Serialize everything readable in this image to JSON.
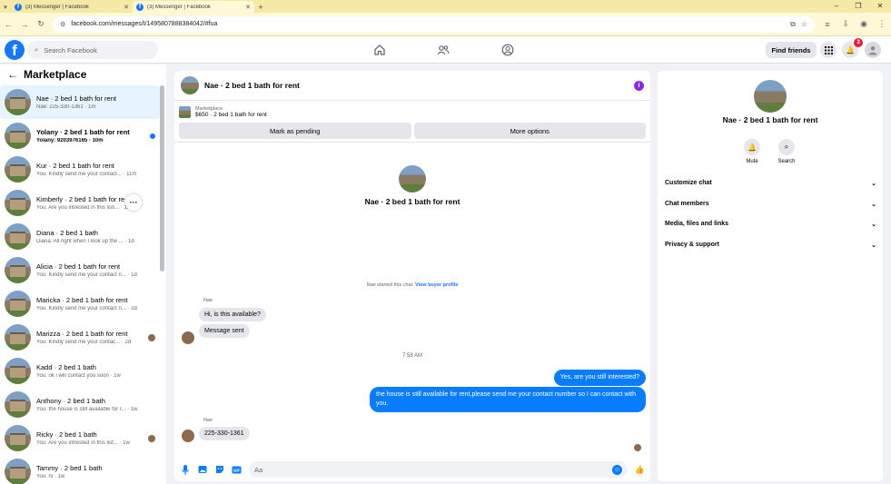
{
  "browser": {
    "tabs": [
      {
        "title": "(3) Messenger | Facebook",
        "active": false
      },
      {
        "title": "(3) Messenger | Facebook",
        "active": true
      }
    ],
    "url": "facebook.com/messages/t/1495807888384042/#fua"
  },
  "header": {
    "search_placeholder": "Search Facebook",
    "find_friends": "Find friends",
    "notification_count": "3"
  },
  "left": {
    "title": "Marketplace",
    "conversations": [
      {
        "name": "Nae · 2 bed 1 bath for rent",
        "preview": "Nae: 225-330-1361 · 1m",
        "selected": true
      },
      {
        "name": "Yolany · 2 bed 1 bath for rent",
        "preview": "Yolany: 9203976165 · 10m",
        "unread": true
      },
      {
        "name": "Kur · 2 bed 1 bath for rent",
        "preview": "You: Kindly send me your contact... · 11m"
      },
      {
        "name": "Kimberly · 2 bed 1 bath for re",
        "preview": "You: Are you intrested in this listi... · 1h"
      },
      {
        "name": "Diana · 2 bed 1 bath",
        "preview": "Diana: All right when I look up the ... · 1d"
      },
      {
        "name": "Alicia · 2 bed 1 bath for rent",
        "preview": "You: Kindly send me your contact n... · 1d"
      },
      {
        "name": "Maricka · 2 bed 1 bath for rent",
        "preview": "You: Kindly send me your contact n... · 2d"
      },
      {
        "name": "Marizza · 2 bed 1 bath for rent",
        "preview": "You: Kindly send me your contac... · 2d"
      },
      {
        "name": "Kadd · 2 bed 1 bath",
        "preview": "You: ok i will contact you soon · 1w"
      },
      {
        "name": "Anthony · 2 bed 1 bath",
        "preview": "You: the house is still available for r... · 1w"
      },
      {
        "name": "Ricky · 2 bed 1 bath",
        "preview": "You: Are you intrested in this list... · 1w"
      },
      {
        "name": "Tammy · 2 bed 1 bath",
        "preview": "You: hi · 1w"
      }
    ]
  },
  "chat": {
    "title": "Nae · 2 bed 1 bath for rent",
    "listing_label": "Marketplace",
    "listing_price": "$650 · 2 bed 1 bath for rent",
    "mark_pending": "Mark as pending",
    "more_options": "More options",
    "intro_name": "Nae · 2 bed 1 bath for rent",
    "started_text": "Nae started this chat.",
    "view_profile": "View buyer profile",
    "sender1": "Nae",
    "msg1": "Hi, is this available?",
    "msg2": "Message sent",
    "time": "7:58 AM",
    "out1": "Yes, are you still interested?",
    "out2": "the house is still available for rent,please send me your contact number so I can contact with you.",
    "sender2": "Nae",
    "msg3": "225-330-1361",
    "composer_placeholder": "Aa"
  },
  "right": {
    "name": "Nae · 2 bed 1 bath for rent",
    "mute": "Mute",
    "search": "Search",
    "sections": [
      "Customize chat",
      "Chat members",
      "Media, files and links",
      "Privacy & support"
    ]
  },
  "colors": {
    "accent": "#1877f2",
    "bubble_out": "#0a7cff"
  }
}
